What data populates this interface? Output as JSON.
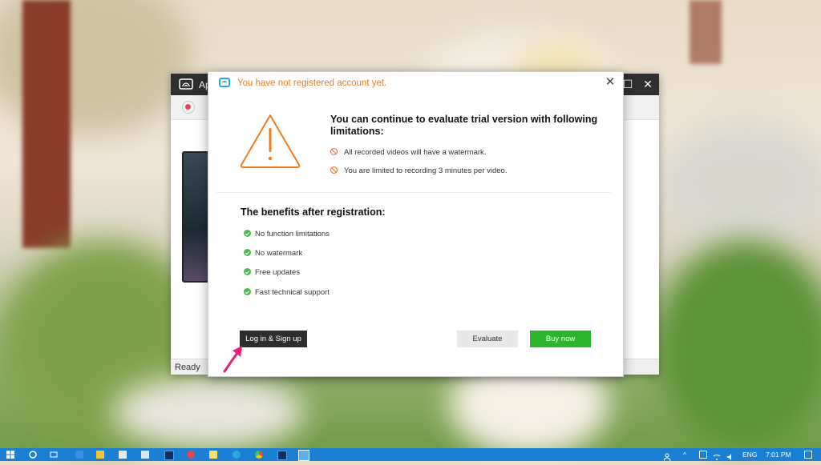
{
  "app_window": {
    "title": "Ap",
    "status": "Ready"
  },
  "dialog": {
    "title": "You have not registered account yet.",
    "limits_title": "You can continue to evaluate trial version with following limitations:",
    "limitations": [
      "All recorded videos will have a watermark.",
      "You are limited to recording 3 minutes per video."
    ],
    "benefits_title": "The benefits after registration:",
    "benefits": [
      "No function limitations",
      "No watermark",
      "Free updates",
      "Fast technical support"
    ],
    "buttons": {
      "login": "Log in & Sign up",
      "evaluate": "Evaluate",
      "buy": "Buy now"
    }
  },
  "taskbar": {
    "language": "ENG",
    "time": "7:01 PM",
    "pinned_icons": [
      "windows-start-icon",
      "cortana-icon",
      "task-view-icon",
      "edge-icon",
      "file-explorer-icon",
      "store-icon",
      "mail-icon",
      "photoshop-icon",
      "record-app-icon",
      "notes-icon",
      "skype-icon",
      "chrome-icon",
      "photoshop-icon",
      "mirror-app-icon"
    ]
  },
  "colors": {
    "accent_orange": "#f07d1d",
    "buy_green": "#2eb52e",
    "check_green": "#4cb84c",
    "taskbar_blue": "#1b7fd3",
    "logo_blue": "#29a8e0",
    "pointer_pink": "#e8207a"
  }
}
